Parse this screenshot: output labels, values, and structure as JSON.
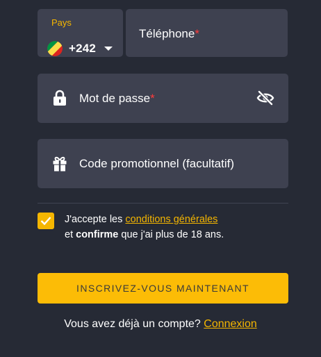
{
  "country_field": {
    "label": "Pays",
    "dial_code": "+242",
    "flag_icon": "congo-flag-icon"
  },
  "phone_field": {
    "placeholder": "Téléphone",
    "required_mark": "*"
  },
  "password_field": {
    "placeholder": "Mot de passe",
    "required_mark": "*",
    "icon": "lock-icon",
    "toggle_icon": "eye-slash-icon"
  },
  "promo_field": {
    "placeholder": "Code promotionnel (facultatif)",
    "icon": "gift-icon"
  },
  "terms": {
    "checked": true,
    "text_1": "J'accepte les ",
    "link": "conditions générales",
    "text_2": "et ",
    "bold": "confirme",
    "text_3": " que j'ai plus de 18 ans."
  },
  "cta": {
    "label": "INSCRIVEZ-VOUS MAINTENANT"
  },
  "login": {
    "text": "Vous avez déjà un compte? ",
    "link": "Connexion"
  },
  "colors": {
    "background": "#262a35",
    "field": "#3e4150",
    "accent": "#f5b600",
    "required": "#ff3b3b"
  }
}
